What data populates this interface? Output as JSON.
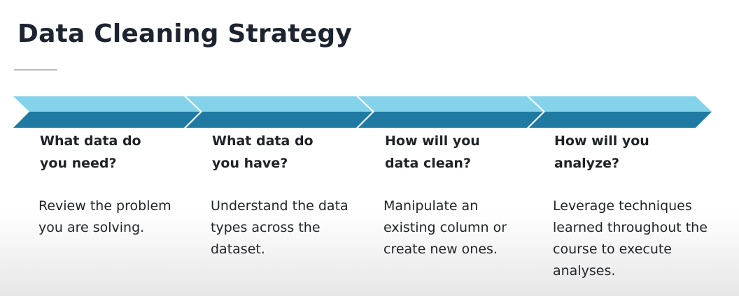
{
  "title": "Data Cleaning Strategy",
  "colors": {
    "arrow_top": "#85d3ea",
    "arrow_bottom": "#1f7aa3",
    "title_rule": "#b9b9b9"
  },
  "steps": [
    {
      "heading": "What data do you need?",
      "description": "Review the problem you are solving."
    },
    {
      "heading": "What data do you have?",
      "description": "Understand the data types across the dataset."
    },
    {
      "heading": "How will you data clean?",
      "description": "Manipulate an existing column or create new ones."
    },
    {
      "heading": "How will you analyze?",
      "description": "Leverage techniques learned throughout the course to execute analyses."
    }
  ]
}
